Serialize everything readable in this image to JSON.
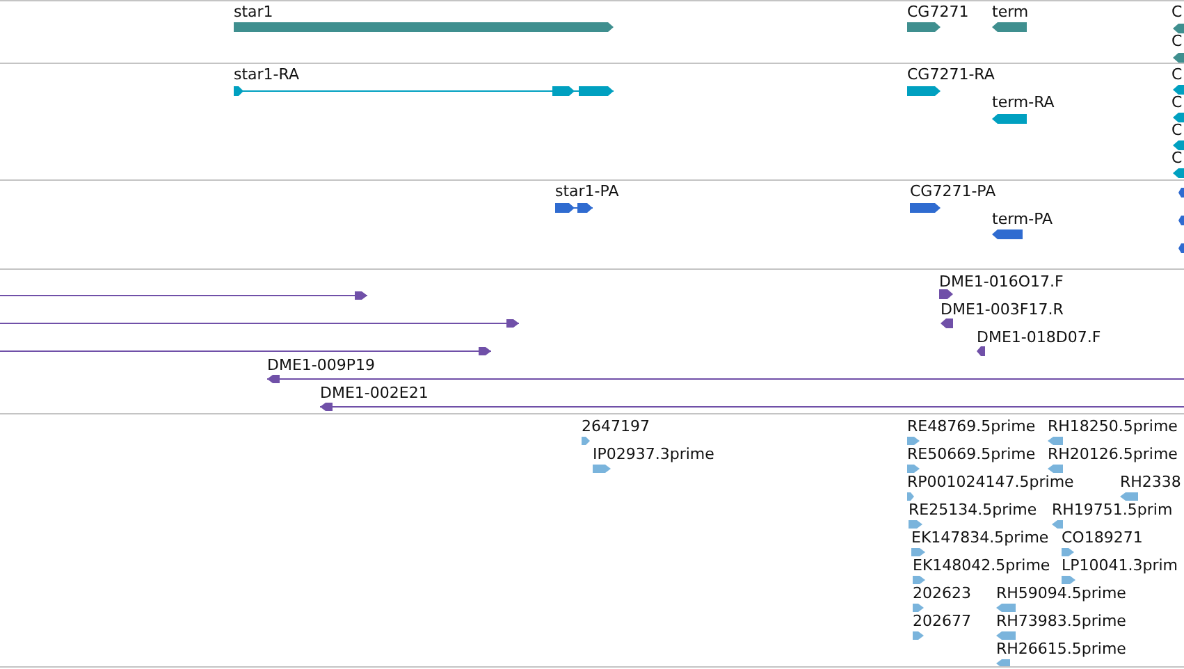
{
  "tracks": [
    {
      "color": "#3f8f8f",
      "features": [
        {
          "label": "star1",
          "kind": "forward-block"
        },
        {
          "label": "CG7271",
          "kind": "forward-block"
        },
        {
          "label": "term",
          "kind": "reverse-block"
        },
        {
          "label": "C",
          "kind": "reverse-block"
        },
        {
          "label": "C",
          "kind": "reverse-block"
        }
      ]
    },
    {
      "color": "#00a0c0",
      "features": [
        {
          "label": "star1-RA",
          "kind": "forward-spliced"
        },
        {
          "label": "CG7271-RA",
          "kind": "forward-block"
        },
        {
          "label": "term-RA",
          "kind": "reverse-block"
        },
        {
          "label": "C",
          "kind": "reverse-block"
        },
        {
          "label": "C",
          "kind": "reverse-block"
        },
        {
          "label": "C",
          "kind": "reverse-block"
        },
        {
          "label": "C",
          "kind": "reverse-block"
        }
      ]
    },
    {
      "color": "#2f6bd0",
      "features": [
        {
          "label": "star1-PA",
          "kind": "forward-spliced"
        },
        {
          "label": "CG7271-PA",
          "kind": "forward-block"
        },
        {
          "label": "term-PA",
          "kind": "reverse-block"
        },
        {
          "kind": "reverse-block"
        },
        {
          "kind": "reverse-block"
        },
        {
          "kind": "reverse-block"
        }
      ]
    },
    {
      "color": "#7050a8",
      "features": [
        {
          "kind": "forward-line"
        },
        {
          "kind": "forward-line"
        },
        {
          "kind": "forward-line"
        },
        {
          "label": "DME1-009P19",
          "kind": "reverse-line"
        },
        {
          "label": "DME1-002E21",
          "kind": "reverse-line"
        },
        {
          "label": "DME1-016O17.F",
          "kind": "forward-block"
        },
        {
          "label": "DME1-003F17.R",
          "kind": "reverse-block"
        },
        {
          "label": "DME1-018D07.F",
          "kind": "reverse-block"
        }
      ]
    },
    {
      "color": "#7ab4dc",
      "features": [
        {
          "label": "2647197",
          "kind": "forward-block"
        },
        {
          "label": "IP02937.3prime",
          "kind": "forward-block"
        },
        {
          "label": "RE48769.5prime",
          "kind": "forward-block"
        },
        {
          "label": "RH18250.5prime",
          "kind": "reverse-block"
        },
        {
          "label": "RE50669.5prime",
          "kind": "forward-block"
        },
        {
          "label": "RH20126.5prime",
          "kind": "reverse-block"
        },
        {
          "label": "RP001024147.5prime",
          "kind": "forward-block"
        },
        {
          "label": "RH2338",
          "kind": "reverse-block"
        },
        {
          "label": "RE25134.5prime",
          "kind": "forward-block"
        },
        {
          "label": "RH19751.5prim",
          "kind": "reverse-block"
        },
        {
          "label": "EK147834.5prime",
          "kind": "forward-block"
        },
        {
          "label": "CO189271",
          "kind": "forward-block"
        },
        {
          "label": "EK148042.5prime",
          "kind": "forward-block"
        },
        {
          "label": "LP10041.3prim",
          "kind": "forward-block"
        },
        {
          "label": "202623",
          "kind": "forward-block"
        },
        {
          "label": "RH59094.5prime",
          "kind": "reverse-block"
        },
        {
          "label": "202677",
          "kind": "forward-block"
        },
        {
          "label": "RH73983.5prime",
          "kind": "reverse-block"
        },
        {
          "label": "RH26615.5prime",
          "kind": "reverse-block"
        }
      ]
    }
  ]
}
